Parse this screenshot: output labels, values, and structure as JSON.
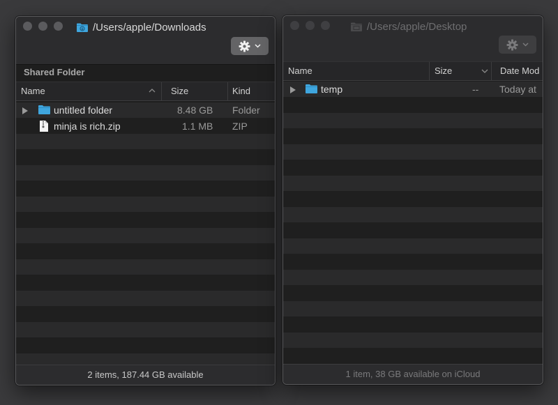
{
  "left_window": {
    "path": "/Users/apple/Downloads",
    "section_label": "Shared Folder",
    "columns": {
      "name": "Name",
      "size": "Size",
      "kind": "Kind"
    },
    "rows": [
      {
        "name": "untitled folder",
        "size": "8.48 GB",
        "kind": "Folder",
        "icon": "folder-icon",
        "expandable": true
      },
      {
        "name": "minja is rich.zip",
        "size": "1.1 MB",
        "kind": "ZIP",
        "icon": "zip-file-icon",
        "expandable": false
      }
    ],
    "status": "2 items, 187.44 GB available"
  },
  "right_window": {
    "path": "/Users/apple/Desktop",
    "columns": {
      "name": "Name",
      "size": "Size",
      "date": "Date Mod"
    },
    "rows": [
      {
        "name": "temp",
        "size": "--",
        "date": "Today at ",
        "icon": "folder-icon",
        "expandable": true
      }
    ],
    "status": "1 item, 38 GB available on iCloud"
  },
  "colors": {
    "folder": "#3fa6de",
    "active_text": "#d8d8d8",
    "inactive_text": "#6e6e70"
  }
}
